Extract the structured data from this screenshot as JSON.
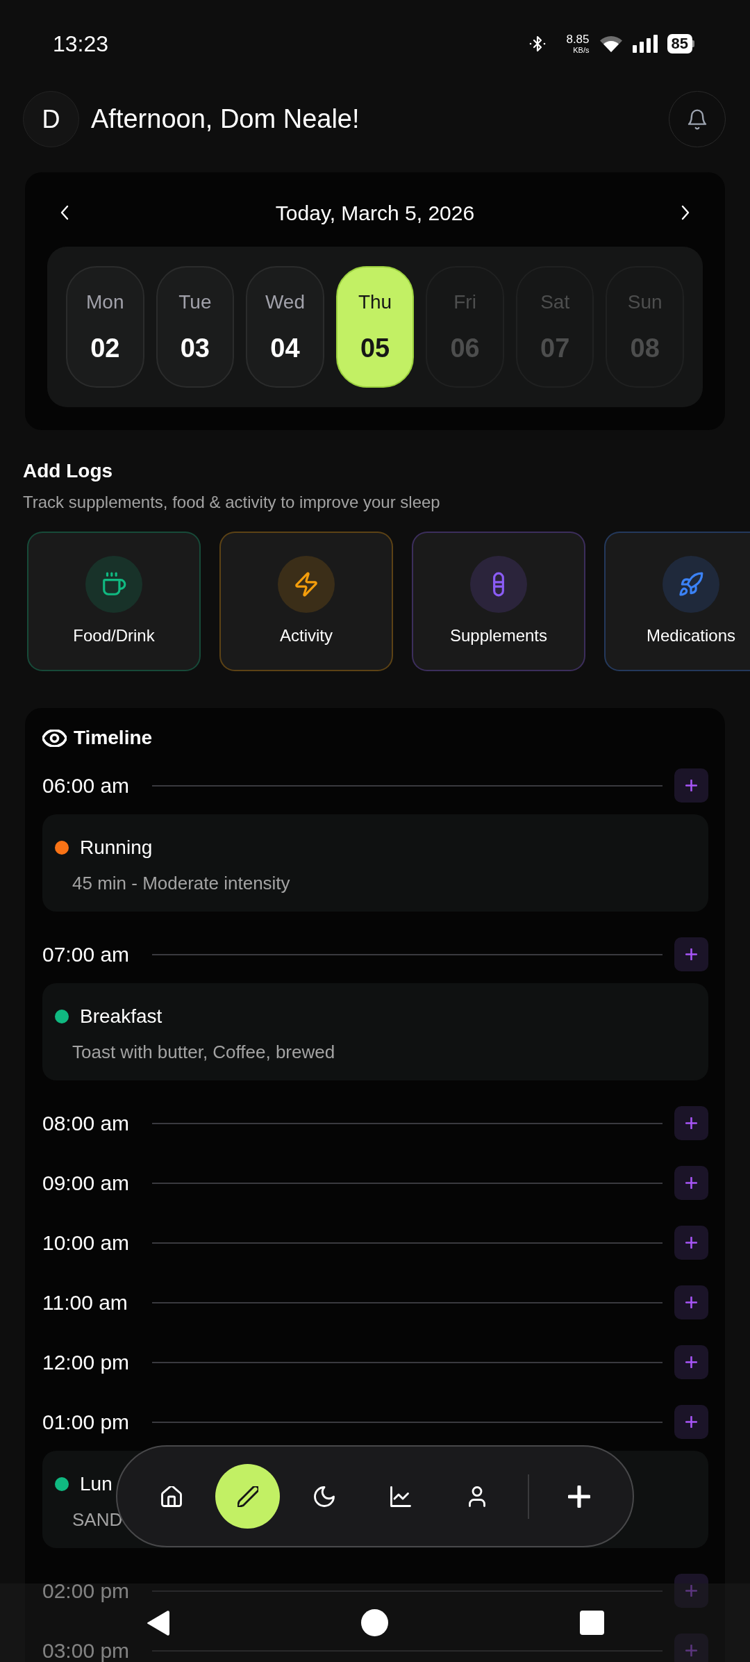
{
  "status_bar": {
    "time": "13:23",
    "network_speed": "8.85",
    "network_unit": "KB/s",
    "battery": "85"
  },
  "header": {
    "avatar_initial": "D",
    "greeting": "Afternoon, Dom Neale!"
  },
  "calendar": {
    "title": "Today, March 5, 2026",
    "days": [
      {
        "day": "Mon",
        "date": "02",
        "selected": false,
        "disabled": false
      },
      {
        "day": "Tue",
        "date": "03",
        "selected": false,
        "disabled": false
      },
      {
        "day": "Wed",
        "date": "04",
        "selected": false,
        "disabled": false
      },
      {
        "day": "Thu",
        "date": "05",
        "selected": true,
        "disabled": false
      },
      {
        "day": "Fri",
        "date": "06",
        "selected": false,
        "disabled": true
      },
      {
        "day": "Sat",
        "date": "07",
        "selected": false,
        "disabled": true
      },
      {
        "day": "Sun",
        "date": "08",
        "selected": false,
        "disabled": true
      }
    ]
  },
  "add_logs": {
    "title": "Add Logs",
    "subtitle": "Track supplements, food & activity to improve your sleep",
    "categories": [
      {
        "label": "Food/Drink",
        "color": "#10b981"
      },
      {
        "label": "Activity",
        "color": "#f59e0b"
      },
      {
        "label": "Supplements",
        "color": "#8b5cf6"
      },
      {
        "label": "Medications",
        "color": "#3b82f6"
      }
    ]
  },
  "timeline": {
    "title": "Timeline",
    "slots": [
      {
        "time": "06:00 am",
        "entries": [
          {
            "title": "Running",
            "detail": "45 min - Moderate intensity",
            "color": "#f97316"
          }
        ]
      },
      {
        "time": "07:00 am",
        "entries": [
          {
            "title": "Breakfast",
            "detail": "Toast with butter, Coffee, brewed",
            "color": "#10b981"
          }
        ]
      },
      {
        "time": "08:00 am"
      },
      {
        "time": "09:00 am"
      },
      {
        "time": "10:00 am"
      },
      {
        "time": "11:00 am"
      },
      {
        "time": "12:00 pm"
      },
      {
        "time": "01:00 pm",
        "entries": [
          {
            "title": "Lun",
            "detail": "SAND",
            "color": "#10b981"
          }
        ]
      },
      {
        "time": "02:00 pm"
      },
      {
        "time": "03:00 pm"
      }
    ]
  },
  "bottom_nav": {
    "items": [
      {
        "selected": false
      },
      {
        "selected": true
      },
      {
        "selected": false
      },
      {
        "selected": false
      },
      {
        "selected": false
      }
    ]
  }
}
